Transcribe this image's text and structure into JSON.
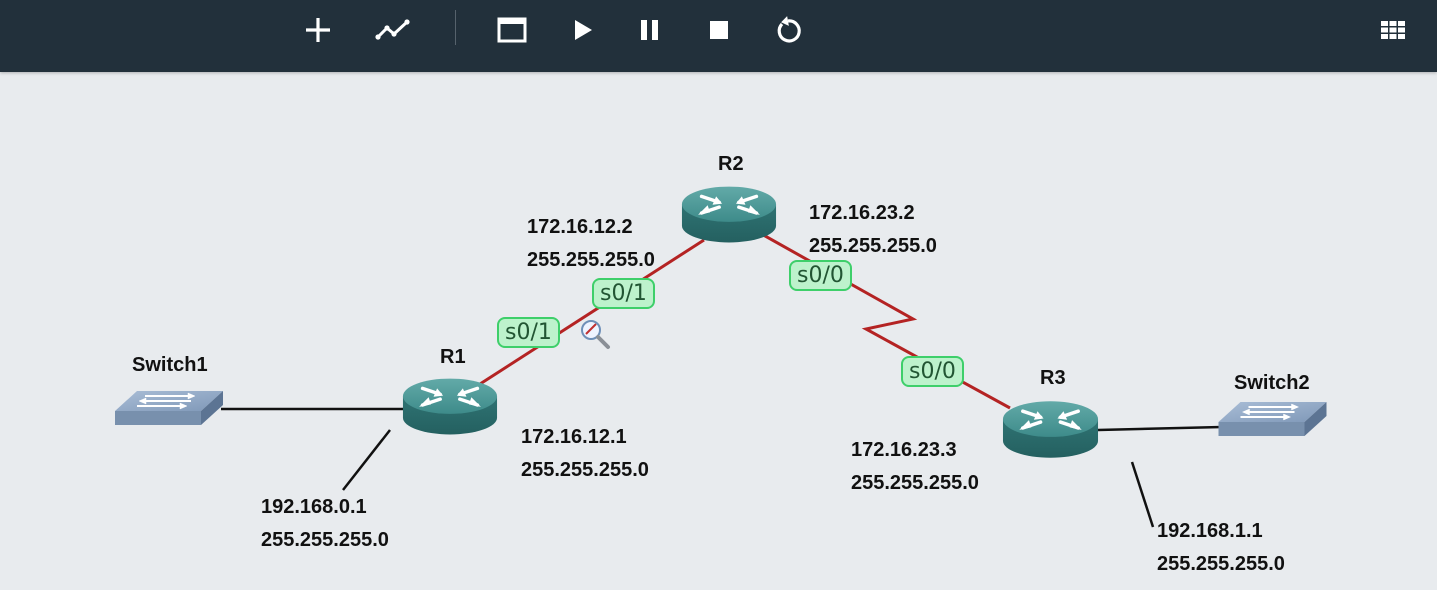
{
  "toolbar": {
    "buttons": [
      {
        "name": "add-icon"
      },
      {
        "name": "link-icon"
      },
      {
        "name": "console-icon"
      },
      {
        "name": "play-icon"
      },
      {
        "name": "pause-icon"
      },
      {
        "name": "stop-icon"
      },
      {
        "name": "reload-icon"
      },
      {
        "name": "grid-icon"
      }
    ]
  },
  "topology": {
    "devices": {
      "r1": {
        "label": "R1"
      },
      "r2": {
        "label": "R2"
      },
      "r3": {
        "label": "R3"
      },
      "switch1": {
        "label": "Switch1"
      },
      "switch2": {
        "label": "Switch2"
      }
    },
    "interfaces": {
      "r1_s01": "s0/1",
      "r2_s01": "s0/1",
      "r2_s00": "s0/0",
      "r3_s00": "s0/0"
    },
    "addresses": {
      "r1_lan": {
        "ip": "192.168.0.1",
        "mask": "255.255.255.0"
      },
      "r1_wan": {
        "ip": "172.16.12.1",
        "mask": "255.255.255.0"
      },
      "r2_left": {
        "ip": "172.16.12.2",
        "mask": "255.255.255.0"
      },
      "r2_right": {
        "ip": "172.16.23.2",
        "mask": "255.255.255.0"
      },
      "r3_wan": {
        "ip": "172.16.23.3",
        "mask": "255.255.255.0"
      },
      "r3_lan": {
        "ip": "192.168.1.1",
        "mask": "255.255.255.0"
      }
    }
  },
  "colors": {
    "toolbar_bg": "#22303b",
    "canvas_bg": "#e8ebee",
    "serial_link": "#b42323",
    "router_teal": "#3c8a8a",
    "interface_badge_bg": "#bdf2cc",
    "interface_badge_border": "#3ecf6a"
  }
}
